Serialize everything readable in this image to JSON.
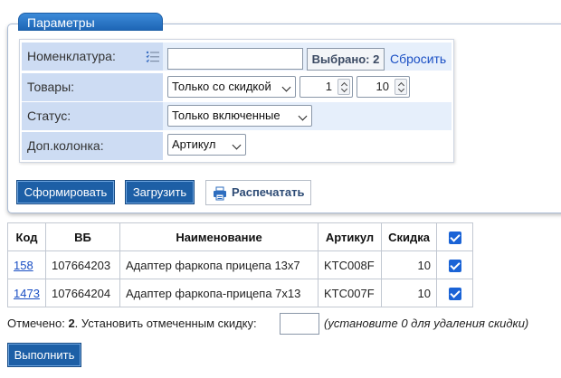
{
  "params": {
    "title": "Параметры",
    "rows": [
      {
        "label": "Номенклатура:"
      },
      {
        "label": "Товары:"
      },
      {
        "label": "Статус:"
      },
      {
        "label": "Доп.колонка:"
      }
    ],
    "nomenclature_value": "",
    "selected_badge": "Выбрано: 2",
    "reset_link": "Сбросить",
    "goods_select": "Только со скидкой",
    "spin_from": "1",
    "spin_to": "10",
    "status_select": "Только включенные",
    "extra_column_select": "Артикул"
  },
  "buttons": {
    "generate": "Сформировать",
    "load": "Загрузить",
    "print": "Распечатать",
    "execute": "Выполнить"
  },
  "table": {
    "headers": [
      "Код",
      "ВБ",
      "Наименование",
      "Артикул",
      "Скидка"
    ],
    "rows": [
      {
        "code": "158",
        "vb": "107664203",
        "name": "Адаптер фаркопа прицепа 13x7",
        "article": "KTC008F",
        "discount": "10"
      },
      {
        "code": "1473",
        "vb": "107664204",
        "name": "Адаптер фаркопа-прицепа 7x13",
        "article": "KTC007F",
        "discount": "10"
      }
    ]
  },
  "footer": {
    "marked_prefix": "Отмечено: ",
    "marked_count": "2",
    "marked_suffix": ". Установить отмеченным скидку:",
    "hint": "(установите 0 для удаления скидки)"
  },
  "colors": {
    "accent": "#1d5fa6",
    "label_bg": "#cddcf3",
    "row_bg": "#e6effb",
    "link": "#1a4fc4",
    "checkbox": "#1a63d6"
  },
  "icons": {
    "list": "list-select-icon",
    "printer": "printer-icon",
    "chevron": "chevron-down-icon",
    "checkbox": "checkbox-checked-icon"
  }
}
